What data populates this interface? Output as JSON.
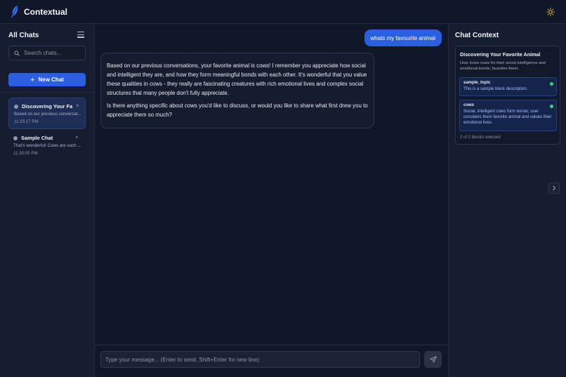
{
  "app": {
    "title": "Contextual"
  },
  "sidebar": {
    "title": "All Chats",
    "search_placeholder": "Search chats...",
    "new_chat_label": "New Chat",
    "chats": [
      {
        "title": "Discovering Your Fa...",
        "preview": "Based on our previous conversat...",
        "time": "11:35:17 PM",
        "close": "×",
        "active": true
      },
      {
        "title": "Sample Chat",
        "preview": "That's wonderful! Cows are such ...",
        "time": "11:35:05 PM",
        "close": "×",
        "active": false
      }
    ]
  },
  "conversation": {
    "user_message": "whats my favourite animal",
    "assistant_paragraphs": [
      "Based on our previous conversations, your favorite animal is cows! I remember you appreciate how social and intelligent they are, and how they form meaningful bonds with each other. It's wonderful that you value these qualities in cows - they really are fascinating creatures with rich emotional lives and complex social structures that many people don't fully appreciate.",
      "Is there anything specific about cows you'd like to discuss, or would you like to share what first drew you to appreciate them so much?"
    ],
    "input_placeholder": "Type your message... (Enter to send, Shift+Enter for new line)"
  },
  "context": {
    "title": "Chat Context",
    "card_title": "Discovering Your Favorite Animal",
    "card_description": "User loves cows for their social intelligence and emotional bonds; favorites them.",
    "blocks": [
      {
        "name": "sample_topic",
        "description": "This is a sample block description."
      },
      {
        "name": "cows",
        "description": "Social, intelligent cows form bonds; user considers them favorite animal and values their emotional lives."
      }
    ],
    "selected_count": "2 of 2 blocks selected"
  },
  "colors": {
    "accent": "#2c5fe0",
    "status_active": "#3fd27a",
    "sun_icon": "#e9b43a"
  }
}
